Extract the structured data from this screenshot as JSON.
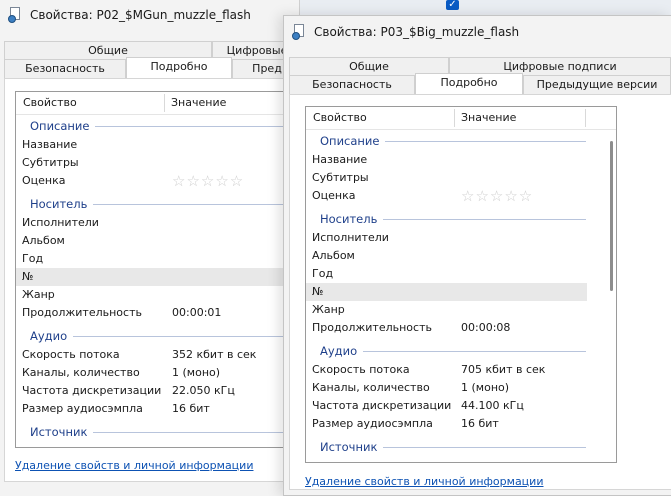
{
  "back_window": {
    "title": "Свойства: P02_$MGun_muzzle_flash",
    "tabs_top": [
      "Общие",
      "Цифровые"
    ],
    "tabs_bottom": [
      "Безопасность",
      "Подробно",
      "Пред"
    ],
    "columns": {
      "property": "Свойство",
      "value": "Значение"
    },
    "groups": {
      "description": "Описание",
      "media": "Носитель",
      "audio": "Аудио",
      "source": "Источник"
    },
    "rows": {
      "title": "Название",
      "subtitles": "Субтитры",
      "rating": "Оценка",
      "artists": "Исполнители",
      "album": "Альбом",
      "year": "Год",
      "number": "№",
      "genre": "Жанр",
      "duration": "Продолжительность",
      "duration_value": "00:00:01",
      "bitrate": "Скорость потока",
      "bitrate_value": "352 кбит в сек",
      "channels": "Каналы, количество",
      "channels_value": "1 (моно)",
      "sample_rate": "Частота дискретизации",
      "sample_rate_value": "22.050 кГц",
      "sample_size": "Размер аудиосэмпла",
      "sample_size_value": "16 бит"
    },
    "rating_stars": "☆☆☆☆☆",
    "remove_link": "Удаление свойств и личной информации"
  },
  "front_window": {
    "title": "Свойства: P03_$Big_muzzle_flash",
    "tabs_top": [
      "Общие",
      "Цифровые подписи"
    ],
    "tabs_bottom": [
      "Безопасность",
      "Подробно",
      "Предыдущие версии"
    ],
    "columns": {
      "property": "Свойство",
      "value": "Значение"
    },
    "groups": {
      "description": "Описание",
      "media": "Носитель",
      "audio": "Аудио",
      "source": "Источник"
    },
    "rows": {
      "title": "Название",
      "subtitles": "Субтитры",
      "rating": "Оценка",
      "artists": "Исполнители",
      "album": "Альбом",
      "year": "Год",
      "number": "№",
      "genre": "Жанр",
      "duration": "Продолжительность",
      "duration_value": "00:00:08",
      "bitrate": "Скорость потока",
      "bitrate_value": "705 кбит в сек",
      "channels": "Каналы, количество",
      "channels_value": "1 (моно)",
      "sample_rate": "Частота дискретизации",
      "sample_rate_value": "44.100 кГц",
      "sample_size": "Размер аудиосэмпла",
      "sample_size_value": "16 бит"
    },
    "rating_stars": "☆☆☆☆☆",
    "remove_link": "Удаление свойств и личной информации"
  },
  "checkbox_glyph": "✓"
}
